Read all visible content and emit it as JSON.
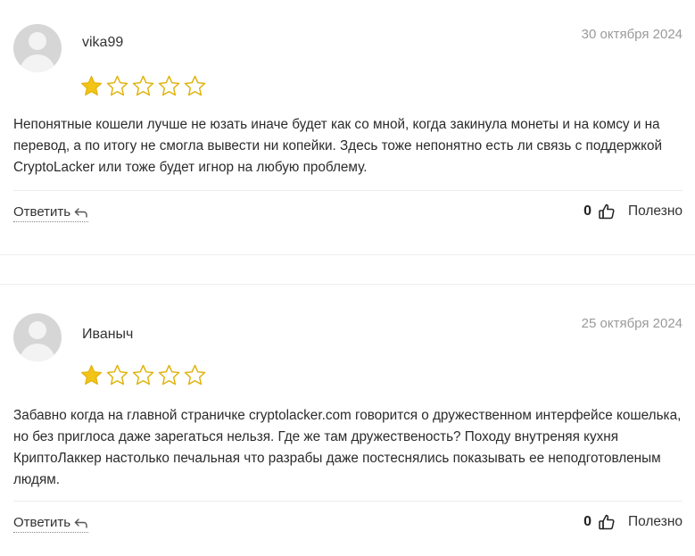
{
  "reviews": [
    {
      "author": "vika99",
      "date": "30 октября 2024",
      "rating": 1,
      "max_rating": 5,
      "text": "Непонятные кошели лучше не юзать иначе будет как со мной, когда закинула монеты и на комсу и на перевод, а по итогу не смогла вывести ни копейки. Здесь тоже непонятно есть ли связь с поддержкой CryptoLacker или тоже будет игнор на любую проблему.",
      "reply_label": "Ответить",
      "helpful_count": "0",
      "helpful_label": "Полезно"
    },
    {
      "author": "Иваныч",
      "date": "25 октября 2024",
      "rating": 1,
      "max_rating": 5,
      "text": "Забавно когда на главной страничке cryptolacker.com говорится о дружественном интерфейсе кошелька, но без приглоса даже зарегаться нельзя. Где же там дружественость? Походу внутреняя кухня КриптоЛаккер настолько печальная что разрабы даже постеснялись показывать ее неподготовленым людям.",
      "reply_label": "Ответить",
      "helpful_count": "0",
      "helpful_label": "Полезно"
    }
  ],
  "icons": {
    "star": "star-icon",
    "reply": "reply-arrow-icon",
    "thumb": "thumbs-up-icon",
    "avatar": "user-avatar-placeholder"
  },
  "colors": {
    "star_filled": "#f3c316",
    "star_outline": "#e0b20c",
    "avatar_bg": "#d6d6d6",
    "date_text": "#9a9a9a"
  }
}
